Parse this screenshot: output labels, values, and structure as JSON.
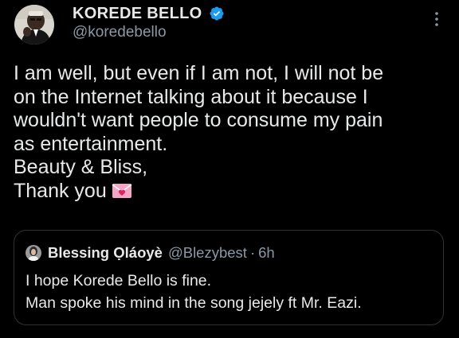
{
  "author": {
    "display_name": "KOREDE BELLO",
    "handle": "@koredebello",
    "verified": true,
    "verified_icon": "verified-badge-icon",
    "avatar_icon": "avatar-photo"
  },
  "menu": {
    "icon": "more-vertical-icon"
  },
  "tweet": {
    "lines": [
      "I am well, but even if I am not, I will not be",
      "on the Internet talking about it because I",
      "wouldn't want people to consume my pain",
      "as entertainment.",
      "Beauty & Bliss,",
      "Thank you"
    ],
    "emoji": "love-letter-emoji"
  },
  "quote": {
    "display_name": "Blessing Ọláoyè",
    "handle": "@Blezybest",
    "separator": "·",
    "time": "6h",
    "lines": [
      "I hope Korede Bello is fine.",
      "Man spoke his mind in the song jejely ft Mr. Eazi."
    ]
  },
  "colors": {
    "background": "#000000",
    "text_primary": "#e7e9ea",
    "text_secondary": "#8b98a5",
    "verified_blue": "#1d9bf0",
    "card_border": "#2f3336",
    "emoji_pink": "#f4a6c4"
  }
}
